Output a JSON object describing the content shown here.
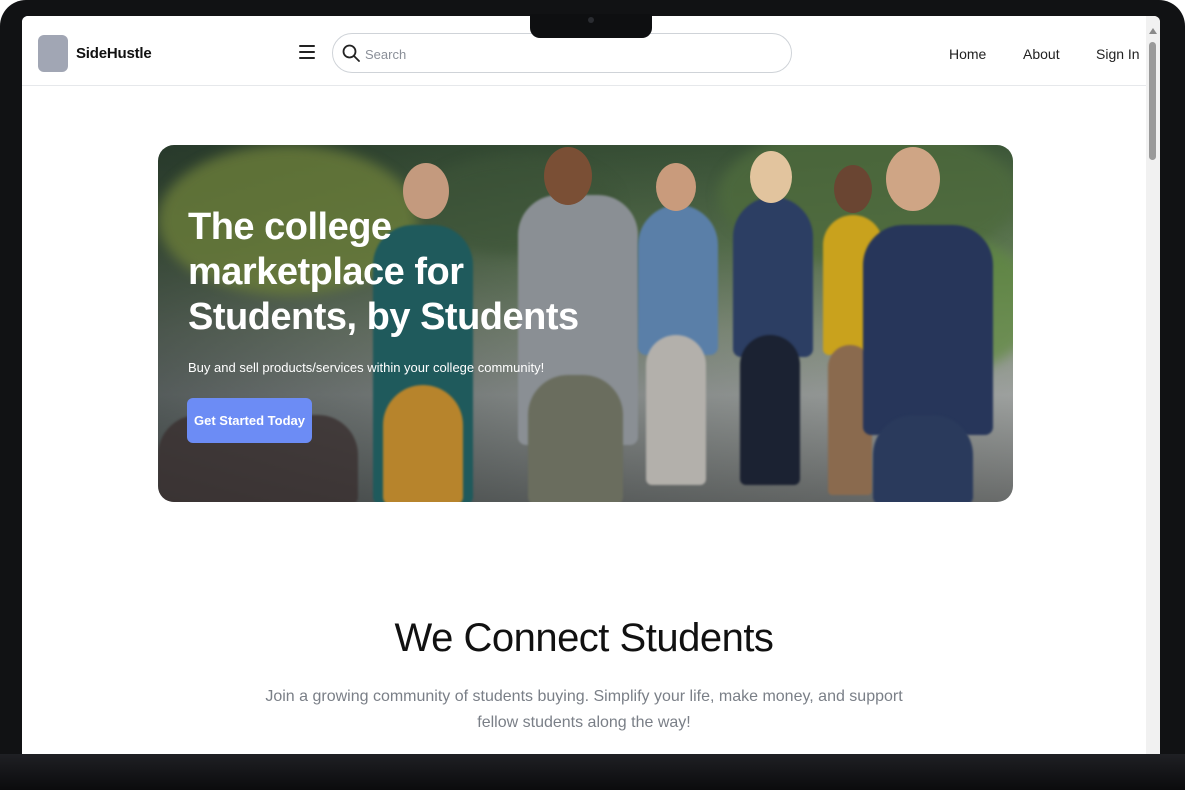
{
  "header": {
    "brand": "SideHustle",
    "search_placeholder": "Search",
    "nav": [
      "Home",
      "About",
      "Sign In"
    ]
  },
  "hero": {
    "title": "The college marketplace for Students, by Students",
    "subtitle": "Buy and sell products/services within your college community!",
    "cta_label": "Get Started Today"
  },
  "connect": {
    "title": "We Connect Students",
    "description": "Join a growing community of students buying. Simplify your life, make money, and support fellow students along the way!"
  },
  "colors": {
    "accent": "#6c8cf5",
    "logo_placeholder": "#a1a6b4",
    "muted_text": "#7a7f87"
  },
  "icons": [
    "menu-icon",
    "search-icon"
  ]
}
